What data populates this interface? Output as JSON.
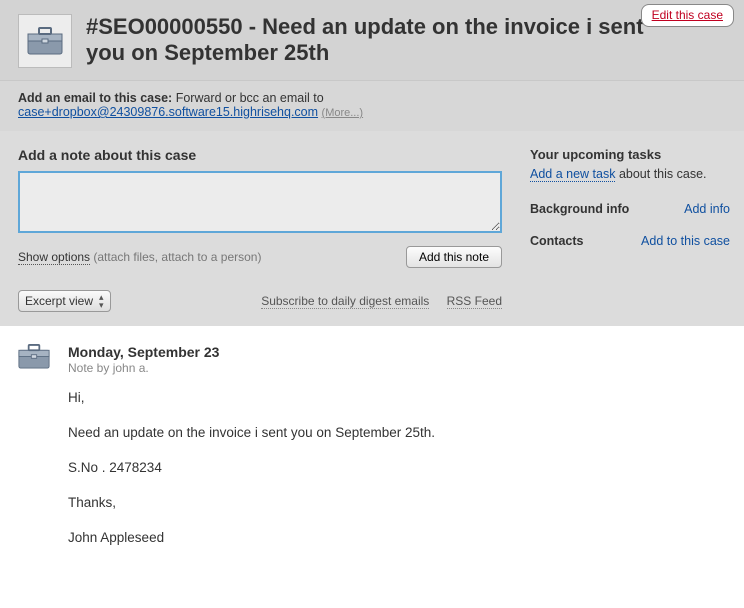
{
  "header": {
    "case_title": "#SEO00000550 - Need an update on the invoice i sent you on September 25th",
    "edit_link": "Edit this case"
  },
  "emailbar": {
    "label": "Add an email to this case:",
    "instruction": " Forward or bcc an email to",
    "address": "case+dropbox@24309876.software15.highrisehq.com",
    "more": "(More...)"
  },
  "note": {
    "heading": "Add a note about this case",
    "value": "",
    "show_options": "Show options",
    "show_options_hint": " (attach files, attach to a person)",
    "add_button": "Add this note"
  },
  "toolbar": {
    "view_label": "Excerpt view",
    "subscribe": "Subscribe to daily digest emails",
    "rss": "RSS Feed"
  },
  "sidebar": {
    "tasks_heading": "Your upcoming tasks",
    "add_task": "Add a new task",
    "add_task_suffix": " about this case.",
    "background_heading": "Background info",
    "background_link": "Add info",
    "contacts_heading": "Contacts",
    "contacts_link": "Add to this case"
  },
  "thread": {
    "date": "Monday, September 23",
    "meta": "Note by john a.",
    "paragraphs": [
      "Hi,",
      "Need an update on the invoice i sent you on September 25th.",
      "S.No . 2478234",
      "Thanks,",
      "John Appleseed"
    ]
  }
}
